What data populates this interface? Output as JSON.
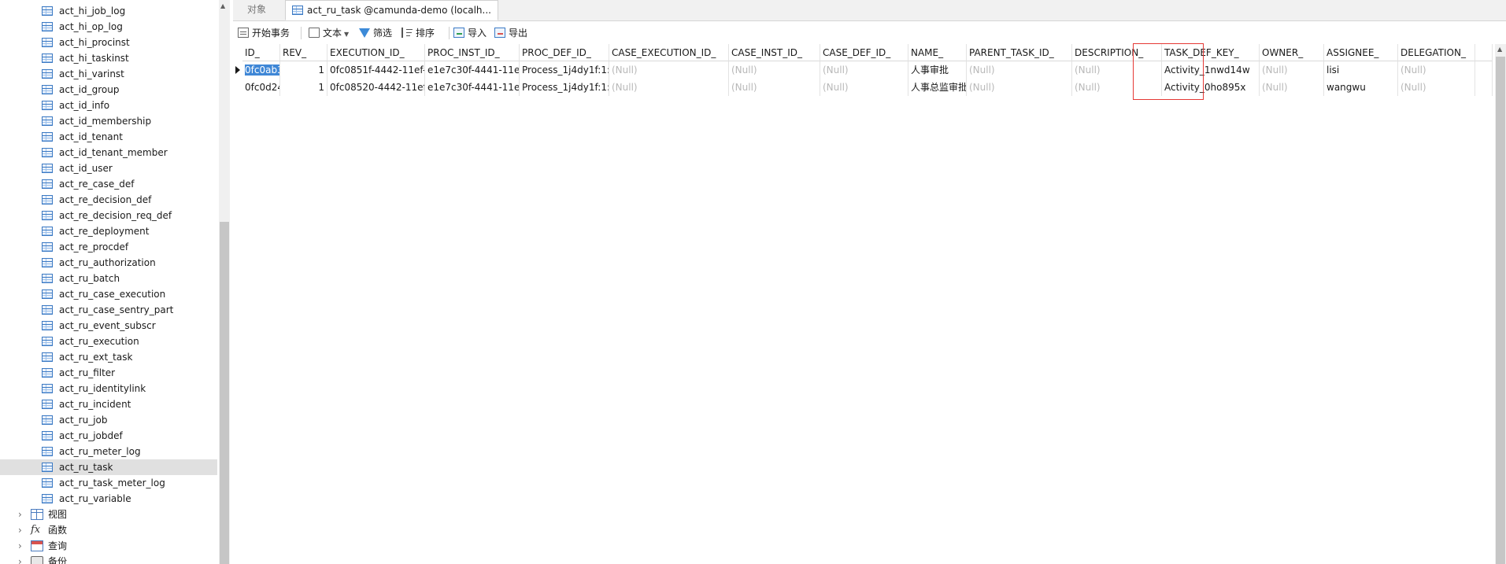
{
  "sidebar": {
    "tables": [
      "act_hi_job_log",
      "act_hi_op_log",
      "act_hi_procinst",
      "act_hi_taskinst",
      "act_hi_varinst",
      "act_id_group",
      "act_id_info",
      "act_id_membership",
      "act_id_tenant",
      "act_id_tenant_member",
      "act_id_user",
      "act_re_case_def",
      "act_re_decision_def",
      "act_re_decision_req_def",
      "act_re_deployment",
      "act_re_procdef",
      "act_ru_authorization",
      "act_ru_batch",
      "act_ru_case_execution",
      "act_ru_case_sentry_part",
      "act_ru_event_subscr",
      "act_ru_execution",
      "act_ru_ext_task",
      "act_ru_filter",
      "act_ru_identitylink",
      "act_ru_incident",
      "act_ru_job",
      "act_ru_jobdef",
      "act_ru_meter_log",
      "act_ru_task",
      "act_ru_task_meter_log",
      "act_ru_variable"
    ],
    "selected_table": "act_ru_task",
    "groups": [
      {
        "label": "视图",
        "icon": "view-icon"
      },
      {
        "label": "函数",
        "icon": "function-icon"
      },
      {
        "label": "查询",
        "icon": "query-icon"
      },
      {
        "label": "备份",
        "icon": "backup-icon"
      }
    ]
  },
  "tabs": [
    {
      "label": "对象",
      "active": false
    },
    {
      "label": "act_ru_task @camunda-demo (localh...",
      "active": true,
      "icon": "table-icon"
    }
  ],
  "toolbar": {
    "begin_transaction": "开始事务",
    "text": "文本",
    "filter": "筛选",
    "sort": "排序",
    "import": "导入",
    "export": "导出"
  },
  "grid": {
    "columns": [
      "ID_",
      "REV_",
      "EXECUTION_ID_",
      "PROC_INST_ID_",
      "PROC_DEF_ID_",
      "CASE_EXECUTION_ID_",
      "CASE_INST_ID_",
      "CASE_DEF_ID_",
      "NAME_",
      "PARENT_TASK_ID_",
      "DESCRIPTION_",
      "TASK_DEF_KEY_",
      "OWNER_",
      "ASSIGNEE_",
      "DELEGATION_",
      ""
    ],
    "rows": [
      [
        "0fc0ab3",
        "1",
        "0fc0851f-4442-11ef-b",
        "e1e7c30f-4441-11ef-",
        "Process_1j4dy1f:1:c",
        "(Null)",
        "(Null)",
        "(Null)",
        "人事审批",
        "(Null)",
        "(Null)",
        "Activity_1nwd14w",
        "(Null)",
        "lisi",
        "(Null)",
        ""
      ],
      [
        "0fc0d24",
        "1",
        "0fc08520-4442-11ef-",
        "e1e7c30f-4441-11ef-",
        "Process_1j4dy1f:1:c",
        "(Null)",
        "(Null)",
        "(Null)",
        "人事总监审批",
        "(Null)",
        "(Null)",
        "Activity_0ho895x",
        "(Null)",
        "wangwu",
        "(Null)",
        ""
      ]
    ],
    "current_row": 0,
    "highlighted_column": "NAME_",
    "selected_cell_text": "0fc0ab3"
  },
  "colors": {
    "selection": "#3f87d6",
    "highlight_box": "#e53935",
    "null_text": "#b8b8b8",
    "selected_nav": "#e0e0e0"
  }
}
